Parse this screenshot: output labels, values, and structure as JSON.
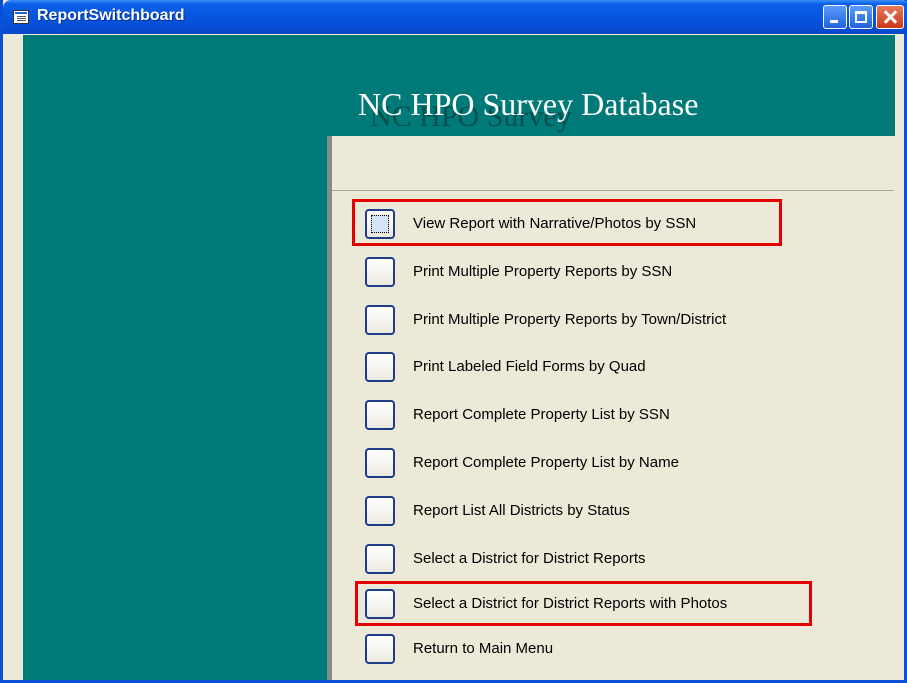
{
  "window": {
    "title": "ReportSwitchboard"
  },
  "header": {
    "title": "NC HPO Survey Database",
    "title_shadow": "NC HPO Survey"
  },
  "menu": {
    "items": [
      {
        "label": "View Report with Narrative/Photos by SSN"
      },
      {
        "label": "Print Multiple Property Reports by SSN"
      },
      {
        "label": "Print Multiple Property Reports by Town/District"
      },
      {
        "label": "Print Labeled Field Forms by Quad"
      },
      {
        "label": "Report Complete Property List by SSN"
      },
      {
        "label": "Report Complete Property List by Name"
      },
      {
        "label": "Report List All Districts by Status"
      },
      {
        "label": "Select a District for District Reports"
      },
      {
        "label": "Select a District for District Reports with Photos"
      },
      {
        "label": "Return to Main Menu"
      }
    ]
  },
  "colors": {
    "teal": "#007a78",
    "highlight": "#e20000",
    "titlebar": "#0553dd"
  },
  "icons": [
    "app-form-icon",
    "minimize-icon",
    "maximize-icon",
    "close-icon"
  ]
}
